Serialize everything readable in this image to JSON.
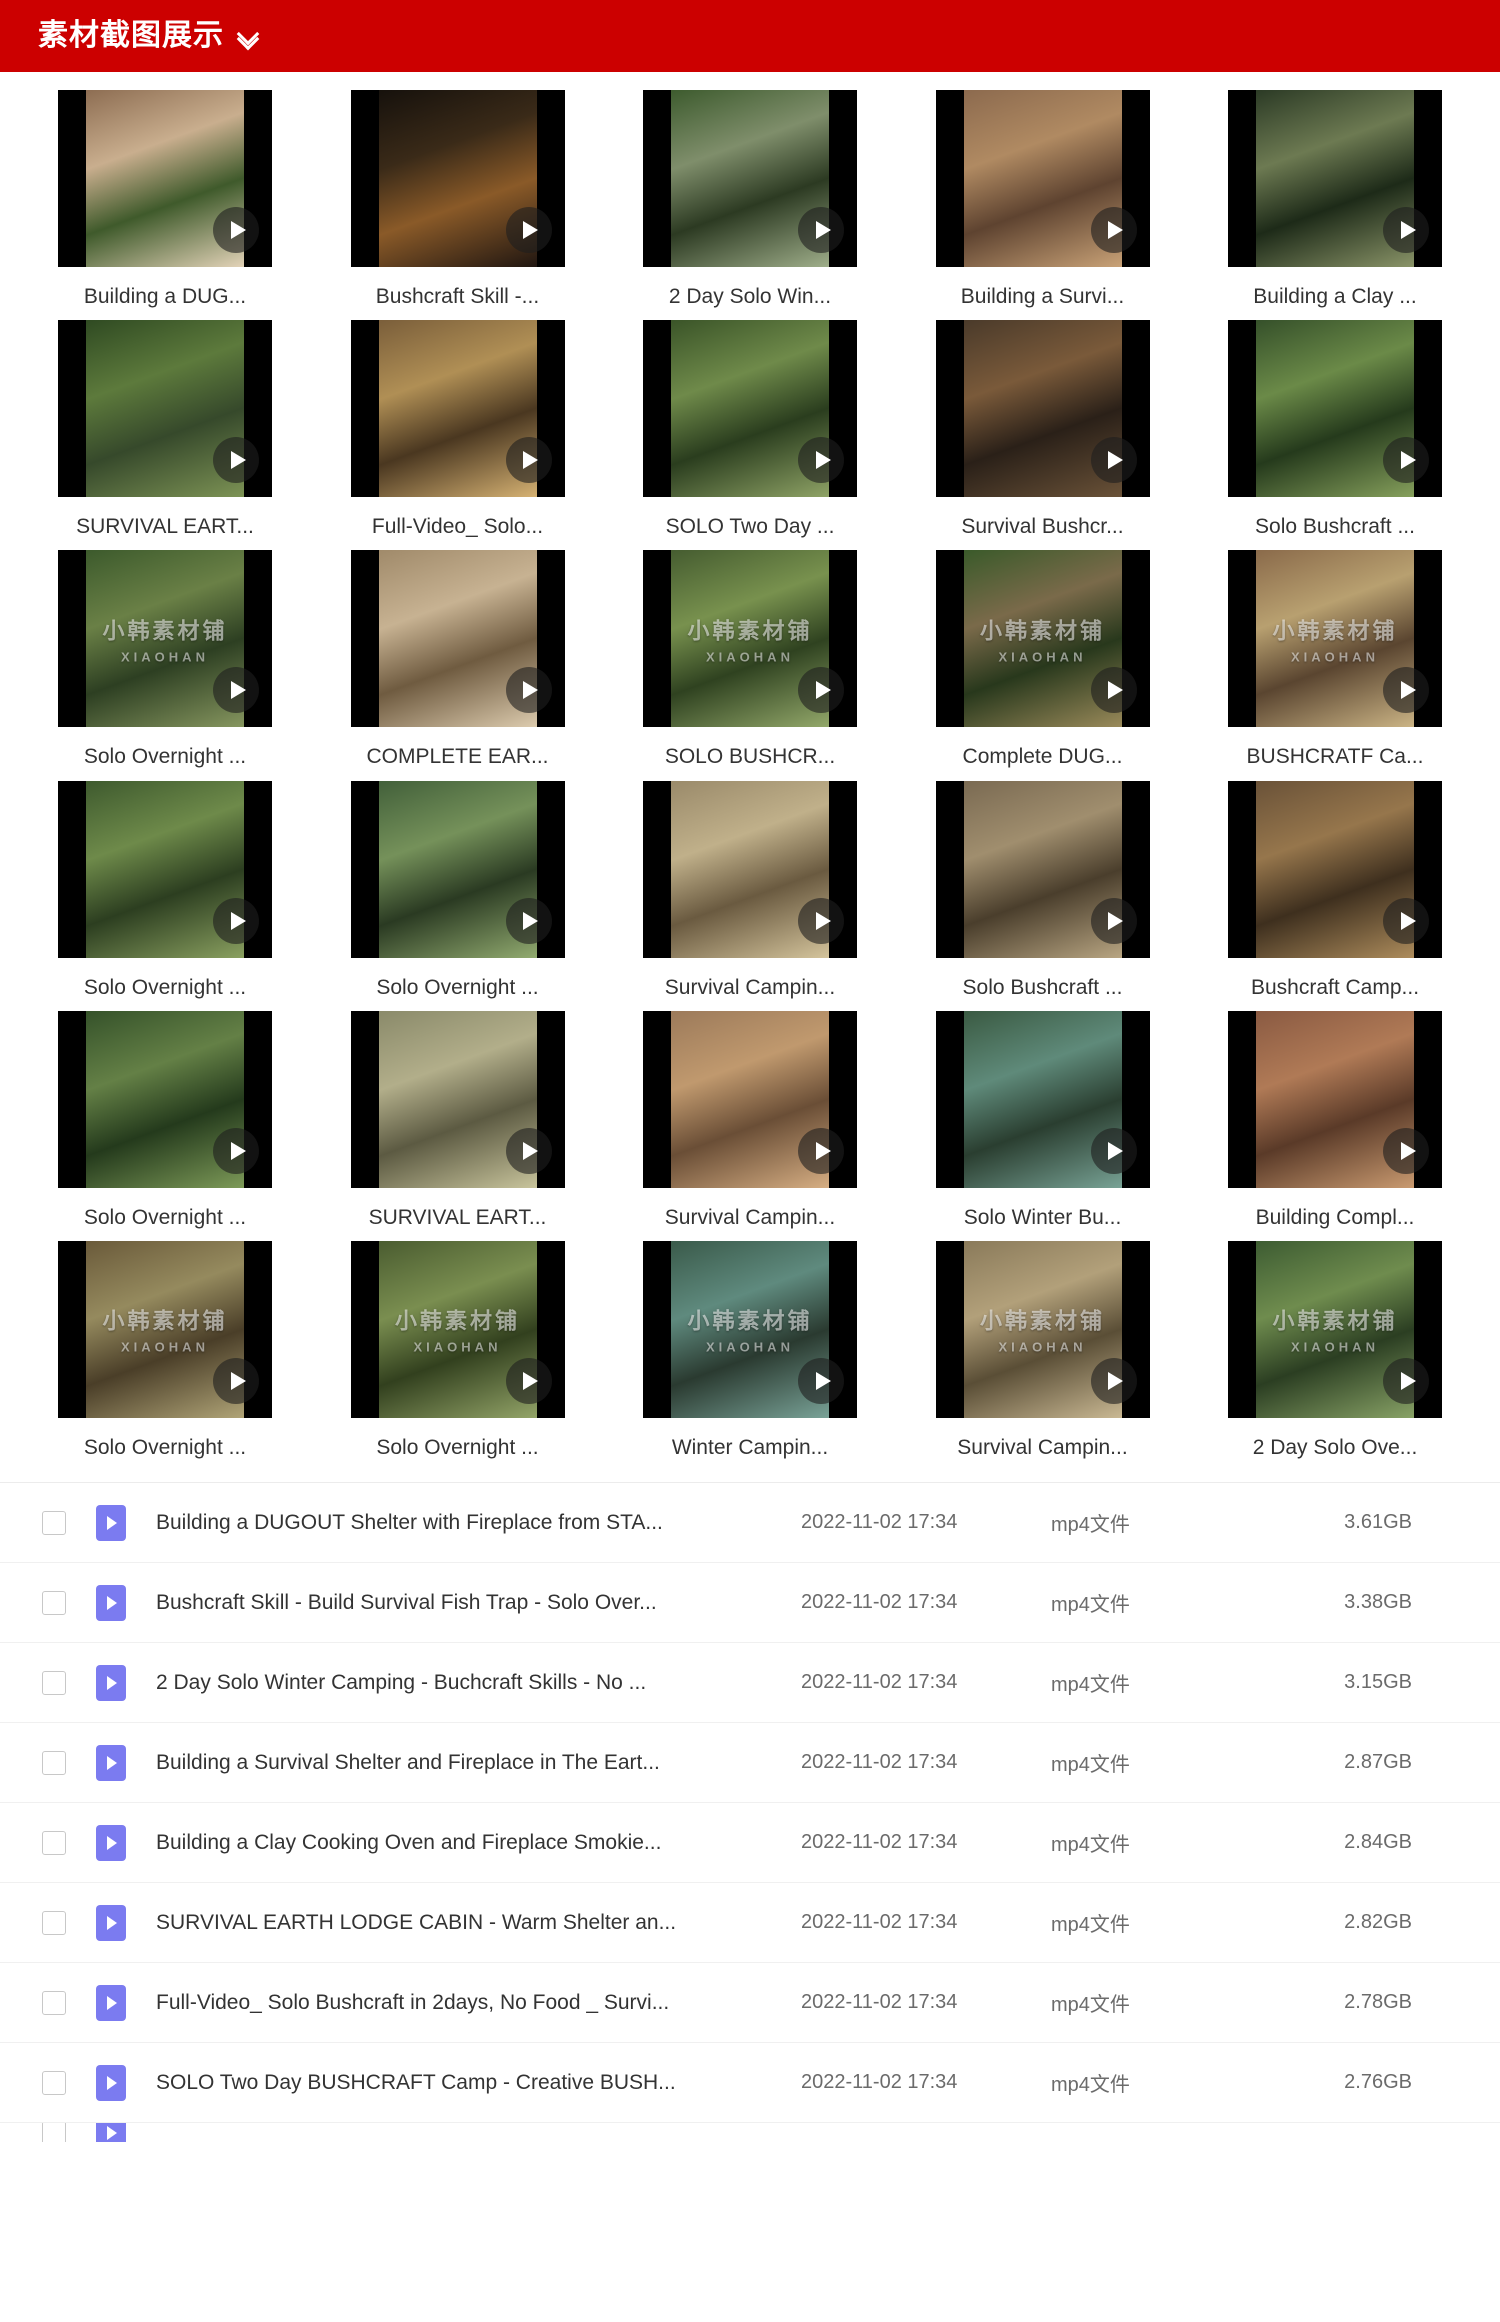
{
  "header": {
    "title": "素材截图展示",
    "expand_icon": "double-chevron-down-icon",
    "bar_color": "#cc0000",
    "text_color": "#ffffff"
  },
  "watermark": {
    "cn": "小韩素材铺",
    "en": "XIAOHAN"
  },
  "thumbnail_grid": {
    "columns": 5,
    "rows": [
      {
        "cells": [
          {
            "caption": "Building a DUG...",
            "play_icon": "play-icon",
            "watermark": false,
            "colors": [
              "#8d6d52",
              "#c9ae8e",
              "#3f5a2b",
              "#e3d3b8"
            ]
          },
          {
            "caption": "Bushcraft Skill -...",
            "play_icon": "play-icon",
            "watermark": false,
            "colors": [
              "#16110c",
              "#3a2a18",
              "#8a5a28",
              "#201611"
            ]
          },
          {
            "caption": "2 Day Solo Win...",
            "play_icon": "play-icon",
            "watermark": false,
            "colors": [
              "#3d5b2e",
              "#7f8e6b",
              "#2c3a22",
              "#9fae8a"
            ]
          },
          {
            "caption": "Building a Survi...",
            "play_icon": "play-icon",
            "watermark": false,
            "colors": [
              "#8c6a4e",
              "#b08a62",
              "#5e4330",
              "#c9a277"
            ]
          },
          {
            "caption": "Building a Clay ...",
            "play_icon": "play-icon",
            "watermark": false,
            "colors": [
              "#2b3a25",
              "#6d7a52",
              "#1d2a18",
              "#8a9468"
            ]
          }
        ]
      },
      {
        "cells": [
          {
            "caption": "SURVIVAL EART...",
            "play_icon": "play-icon",
            "watermark": false,
            "colors": [
              "#2f4a22",
              "#5d7a3c",
              "#36492b",
              "#7d9355"
            ]
          },
          {
            "caption": "Full-Video_ Solo...",
            "play_icon": "play-icon",
            "watermark": false,
            "colors": [
              "#7a5e3a",
              "#b08f55",
              "#4a3720",
              "#d6b273"
            ]
          },
          {
            "caption": "SOLO Two Day ...",
            "play_icon": "play-icon",
            "watermark": false,
            "colors": [
              "#3a5428",
              "#6f8a4a",
              "#2a3d1e",
              "#8fa366"
            ]
          },
          {
            "caption": "Survival Bushcr...",
            "play_icon": "play-icon",
            "watermark": false,
            "colors": [
              "#4a3a2a",
              "#7a5a3a",
              "#2a2018",
              "#6a5238"
            ]
          },
          {
            "caption": "Solo Bushcraft ...",
            "play_icon": "play-icon",
            "watermark": false,
            "colors": [
              "#35502a",
              "#6b8a48",
              "#253a1c",
              "#86a05c"
            ]
          }
        ]
      },
      {
        "cells": [
          {
            "caption": "Solo Overnight ...",
            "play_icon": "play-icon",
            "watermark": true,
            "colors": [
              "#3c5a2c",
              "#6a8046",
              "#2d3f22",
              "#86965f"
            ]
          },
          {
            "caption": "COMPLETE EAR...",
            "play_icon": "play-icon",
            "watermark": false,
            "colors": [
              "#a08a6a",
              "#c7b292",
              "#6f5b40",
              "#dccbae"
            ]
          },
          {
            "caption": "SOLO BUSHCR...",
            "play_icon": "play-icon",
            "watermark": true,
            "colors": [
              "#455c30",
              "#78914e",
              "#2f4220",
              "#93a86a"
            ]
          },
          {
            "caption": "Complete DUG...",
            "play_icon": "play-icon",
            "watermark": true,
            "colors": [
              "#3a5a2a",
              "#7a6a4a",
              "#28381c",
              "#9a8a5a"
            ]
          },
          {
            "caption": "BUSHCRATF Ca...",
            "play_icon": "play-icon",
            "watermark": true,
            "colors": [
              "#8a6a4a",
              "#b8a070",
              "#5a4530",
              "#cbb485"
            ]
          }
        ]
      },
      {
        "cells": [
          {
            "caption": "Solo Overnight ...",
            "play_icon": "play-icon",
            "watermark": false,
            "colors": [
              "#3e5a2e",
              "#6e8a4a",
              "#2c3e20",
              "#8aa060"
            ]
          },
          {
            "caption": "Solo Overnight ...",
            "play_icon": "play-icon",
            "watermark": false,
            "colors": [
              "#42603a",
              "#75915a",
              "#2a3a22",
              "#92ab70"
            ]
          },
          {
            "caption": "Survival Campin...",
            "play_icon": "play-icon",
            "watermark": false,
            "colors": [
              "#9a8a6a",
              "#c0b08a",
              "#6a5a40",
              "#d4c49c"
            ]
          },
          {
            "caption": "Solo Bushcraft ...",
            "play_icon": "play-icon",
            "watermark": false,
            "colors": [
              "#7a6a52",
              "#a08e6e",
              "#4a3e2c",
              "#b8a582"
            ]
          },
          {
            "caption": "Bushcraft Camp...",
            "play_icon": "play-icon",
            "watermark": false,
            "colors": [
              "#6a5238",
              "#96764c",
              "#3e2f1e",
              "#ad8c5c"
            ]
          }
        ]
      },
      {
        "cells": [
          {
            "caption": "Solo Overnight ...",
            "play_icon": "play-icon",
            "watermark": false,
            "colors": [
              "#35522a",
              "#648046",
              "#243a1c",
              "#7d9a58"
            ]
          },
          {
            "caption": "SURVIVAL EART...",
            "play_icon": "play-icon",
            "watermark": false,
            "colors": [
              "#8a8a6a",
              "#b2ae8a",
              "#5c5a42",
              "#c8c49c"
            ]
          },
          {
            "caption": "Survival Campin...",
            "play_icon": "play-icon",
            "watermark": false,
            "colors": [
              "#9c7a5a",
              "#c0996e",
              "#6a4e36",
              "#d6ae83"
            ]
          },
          {
            "caption": "Solo Winter Bu...",
            "play_icon": "play-icon",
            "watermark": false,
            "colors": [
              "#3a5a42",
              "#5f8a7a",
              "#2a3e30",
              "#78a295"
            ]
          },
          {
            "caption": "Building Compl...",
            "play_icon": "play-icon",
            "watermark": false,
            "colors": [
              "#8a5a42",
              "#b07a56",
              "#5a3a28",
              "#c99a70"
            ]
          }
        ]
      },
      {
        "cells": [
          {
            "caption": "Solo Overnight ...",
            "play_icon": "play-icon",
            "watermark": true,
            "colors": [
              "#6a5a3a",
              "#958a5e",
              "#4a3e28",
              "#b0a477"
            ]
          },
          {
            "caption": "Solo Overnight ...",
            "play_icon": "play-icon",
            "watermark": true,
            "colors": [
              "#4a5c30",
              "#7a8e50",
              "#32401e",
              "#93a468"
            ]
          },
          {
            "caption": "Winter Campin...",
            "play_icon": "play-icon",
            "watermark": true,
            "colors": [
              "#3a5a4a",
              "#5f8a7e",
              "#2a3a30",
              "#79a297"
            ]
          },
          {
            "caption": "Survival Campin...",
            "play_icon": "play-icon",
            "watermark": true,
            "colors": [
              "#8a7a5a",
              "#b2a07a",
              "#5a4e36",
              "#c9b893"
            ]
          },
          {
            "caption": "2 Day Solo Ove...",
            "play_icon": "play-icon",
            "watermark": true,
            "colors": [
              "#3d5c32",
              "#6f8c4e",
              "#2b3e22",
              "#88a266"
            ]
          }
        ]
      }
    ]
  },
  "file_list": {
    "row_icon": "video-file-icon",
    "checkbox_icon": "checkbox-unchecked-icon",
    "rows": [
      {
        "name": "Building a DUGOUT Shelter with Fireplace from STA...",
        "date": "2022-11-02 17:34",
        "type": "mp4文件",
        "size": "3.61GB"
      },
      {
        "name": "Bushcraft Skill - Build Survival Fish Trap - Solo Over...",
        "date": "2022-11-02 17:34",
        "type": "mp4文件",
        "size": "3.38GB"
      },
      {
        "name": "2 Day Solo Winter Camping - Buchcraft Skills - No ...",
        "date": "2022-11-02 17:34",
        "type": "mp4文件",
        "size": "3.15GB"
      },
      {
        "name": "Building a Survival Shelter and Fireplace in The Eart...",
        "date": "2022-11-02 17:34",
        "type": "mp4文件",
        "size": "2.87GB"
      },
      {
        "name": "Building a Clay Cooking Oven and Fireplace Smokie...",
        "date": "2022-11-02 17:34",
        "type": "mp4文件",
        "size": "2.84GB"
      },
      {
        "name": "SURVIVAL EARTH LODGE CABIN - Warm Shelter an...",
        "date": "2022-11-02 17:34",
        "type": "mp4文件",
        "size": "2.82GB"
      },
      {
        "name": "Full-Video_ Solo Bushcraft in 2days, No Food _ Survi...",
        "date": "2022-11-02 17:34",
        "type": "mp4文件",
        "size": "2.78GB"
      },
      {
        "name": "SOLO Two Day BUSHCRAFT Camp - Creative BUSH...",
        "date": "2022-11-02 17:34",
        "type": "mp4文件",
        "size": "2.76GB"
      }
    ]
  }
}
